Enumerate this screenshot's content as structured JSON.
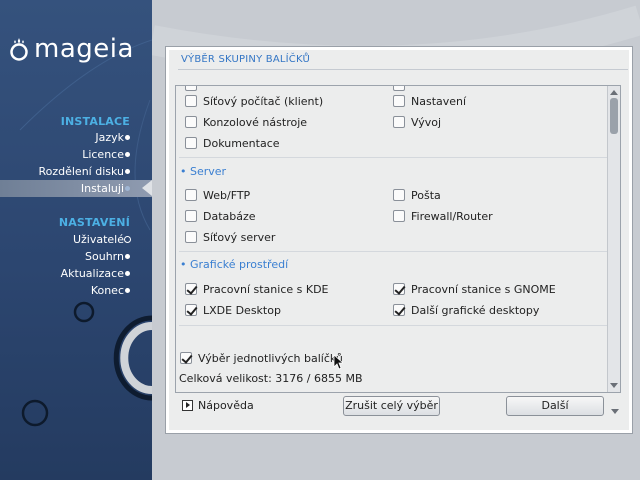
{
  "brand": {
    "logo_text": "mageia"
  },
  "sidebar": {
    "sections": [
      {
        "title": "INSTALACE",
        "items": [
          {
            "label": "Jazyk",
            "state": "done"
          },
          {
            "label": "Licence",
            "state": "done"
          },
          {
            "label": "Rozdělení disku",
            "state": "done"
          },
          {
            "label": "Instaluji",
            "state": "current"
          }
        ]
      },
      {
        "title": "NASTAVENÍ",
        "items": [
          {
            "label": "Uživatelé",
            "state": "next"
          },
          {
            "label": "Souhrn",
            "state": "todo"
          },
          {
            "label": "Aktualizace",
            "state": "todo"
          },
          {
            "label": "Konec",
            "state": "todo"
          }
        ]
      }
    ]
  },
  "panel": {
    "title": "VÝBĚR SKUPINY BALÍČKŮ",
    "groups": [
      {
        "name": "",
        "items": [
          {
            "label": "Síťový počítač (klient)",
            "checked": false
          },
          {
            "label": "Nastavení",
            "checked": false
          },
          {
            "label": "Konzolové nástroje",
            "checked": false
          },
          {
            "label": "Vývoj",
            "checked": false
          },
          {
            "label": "Dokumentace",
            "checked": false
          }
        ]
      },
      {
        "name": "Server",
        "items": [
          {
            "label": "Web/FTP",
            "checked": false
          },
          {
            "label": "Pošta",
            "checked": false
          },
          {
            "label": "Databáze",
            "checked": false
          },
          {
            "label": "Firewall/Router",
            "checked": false
          },
          {
            "label": "Síťový server",
            "checked": false
          }
        ]
      },
      {
        "name": "Grafické prostředí",
        "items": [
          {
            "label": "Pracovní stanice s KDE",
            "checked": true
          },
          {
            "label": "Pracovní stanice s GNOME",
            "checked": true
          },
          {
            "label": "LXDE Desktop",
            "checked": true
          },
          {
            "label": "Další grafické desktopy",
            "checked": true
          }
        ]
      }
    ],
    "individual_selection": {
      "label": "Výběr jednotlivých balíčků",
      "checked": true
    },
    "total_size": "Celková velikost: 3176 / 6855 MB",
    "help_label": "Nápověda",
    "deselect_all_label": "Zrušit celý výběr",
    "next_label": "Další"
  },
  "colors": {
    "sidebar_bg": "#2c4670",
    "section_title": "#4cb0e4",
    "panel_title": "#3476c5",
    "group_header": "#3a7fd1"
  }
}
